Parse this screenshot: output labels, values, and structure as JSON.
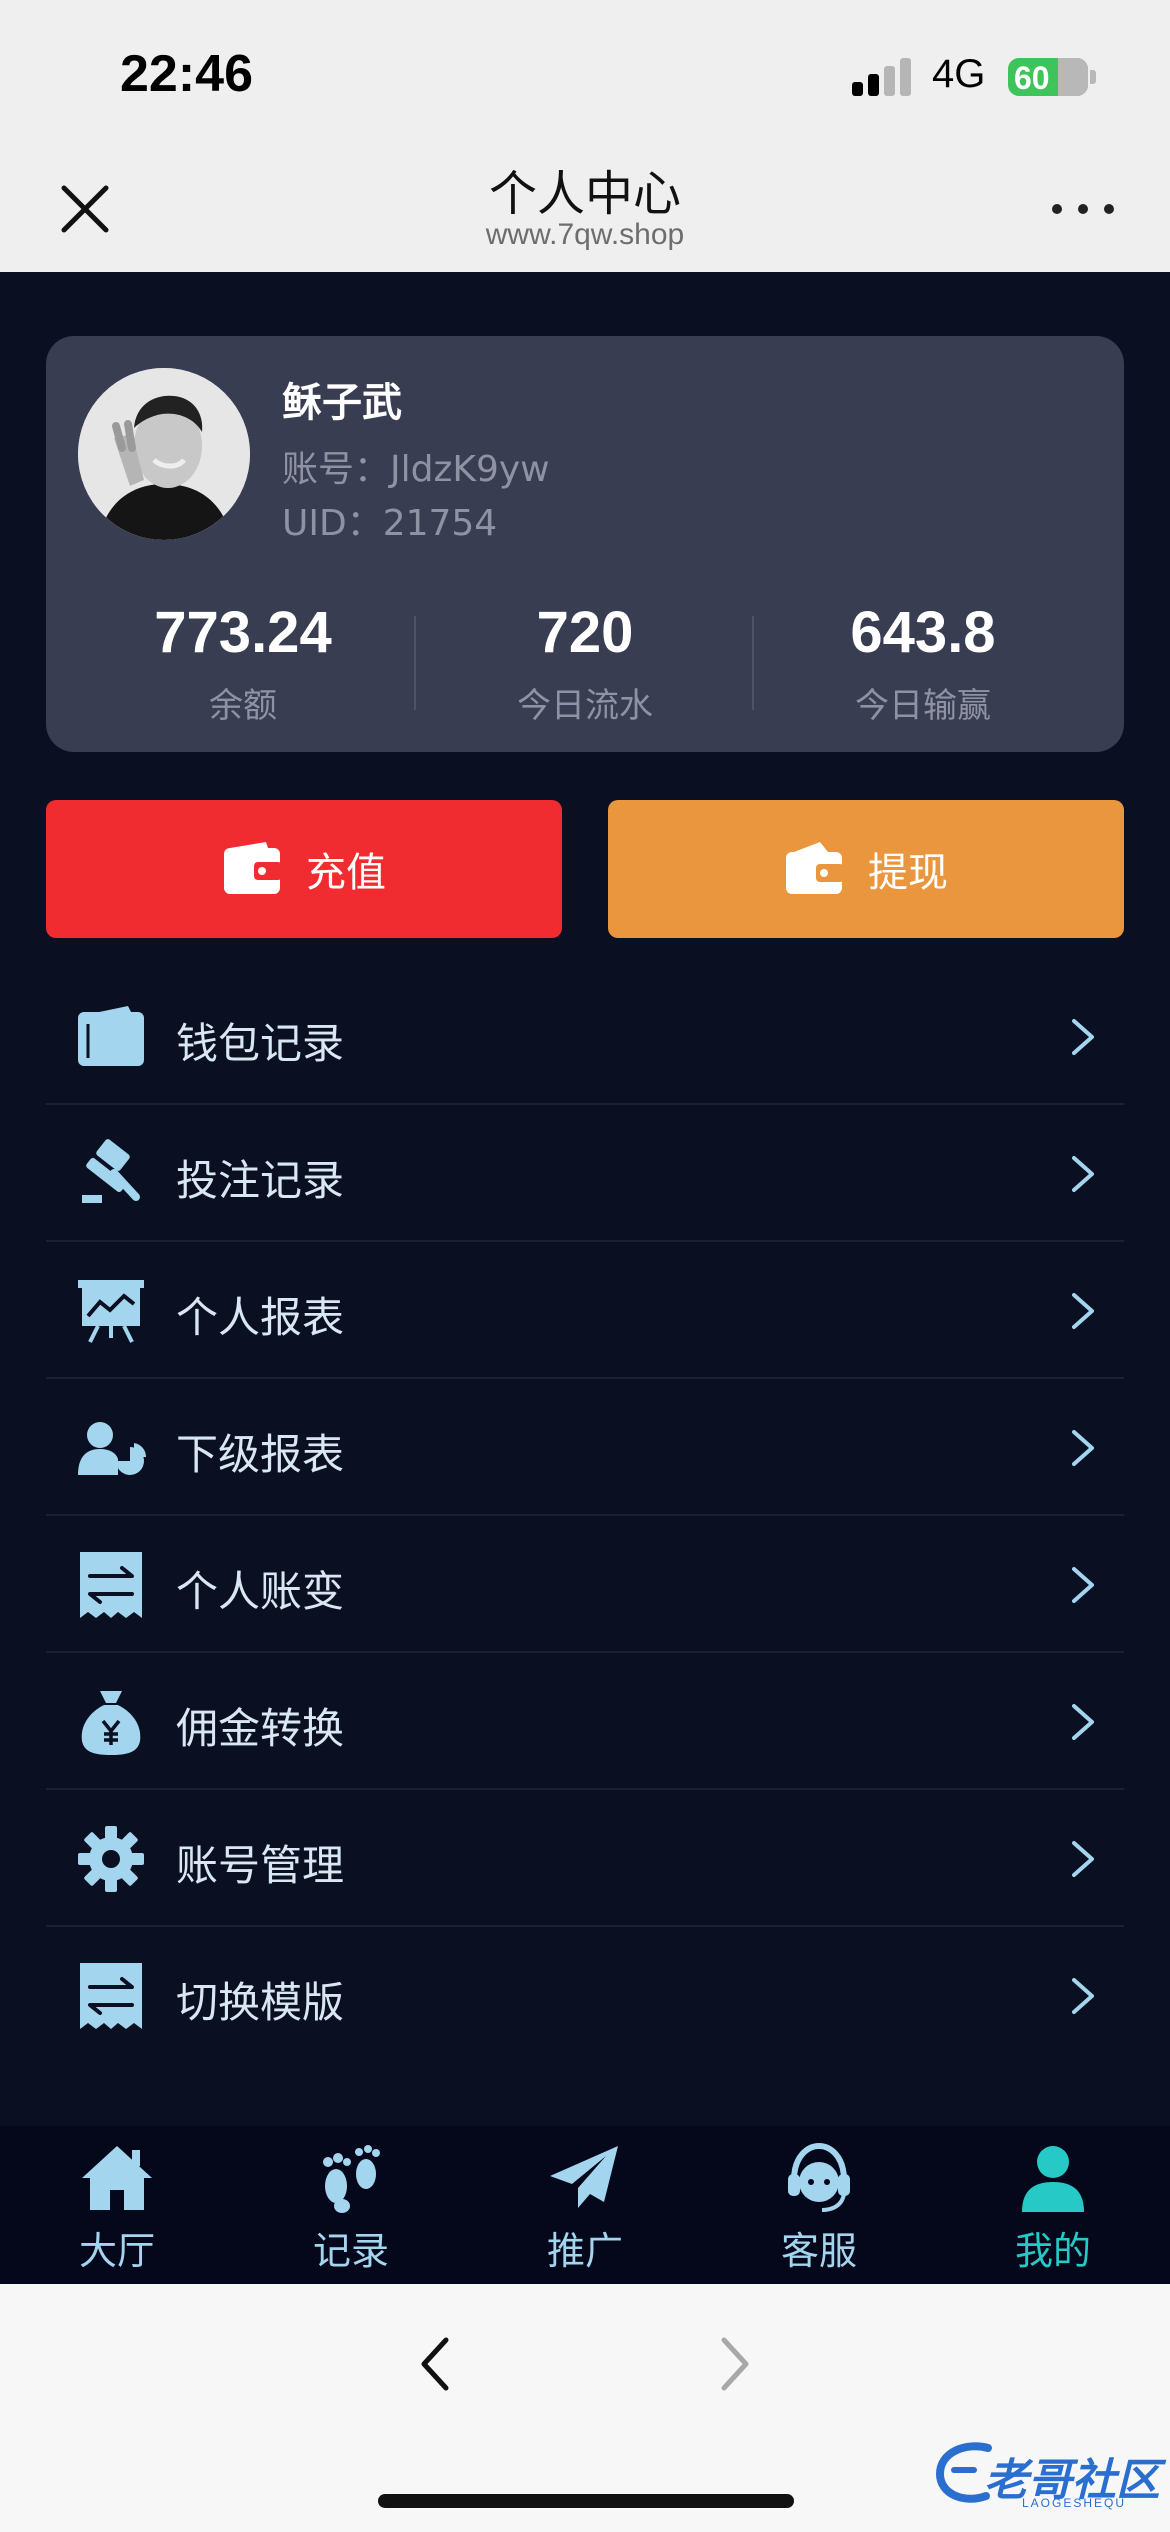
{
  "status_bar": {
    "time": "22:46",
    "network": "4G",
    "battery": "60"
  },
  "header": {
    "title": "个人中心",
    "subtitle": "www.7qw.shop"
  },
  "profile": {
    "name": "稣子武",
    "account": "账号：JldzK9yw",
    "uid": "UID：21754"
  },
  "stats": [
    {
      "value": "773.24",
      "label": "余额"
    },
    {
      "value": "720",
      "label": "今日流水"
    },
    {
      "value": "643.8",
      "label": "今日输赢"
    }
  ],
  "actions": {
    "recharge": "充值",
    "withdraw": "提现"
  },
  "menu": [
    {
      "label": "钱包记录",
      "icon": "wallet-icon"
    },
    {
      "label": "投注记录",
      "icon": "gavel-icon"
    },
    {
      "label": "个人报表",
      "icon": "chart-board-icon"
    },
    {
      "label": "下级报表",
      "icon": "user-pie-icon"
    },
    {
      "label": "个人账变",
      "icon": "transfer-receipt-icon"
    },
    {
      "label": "佣金转换",
      "icon": "money-bag-icon"
    },
    {
      "label": "账号管理",
      "icon": "gear-icon"
    },
    {
      "label": "切换模版",
      "icon": "switch-receipt-icon"
    }
  ],
  "tabs": [
    {
      "label": "大厅",
      "icon": "home-icon"
    },
    {
      "label": "记录",
      "icon": "footprint-icon"
    },
    {
      "label": "推广",
      "icon": "paper-plane-icon"
    },
    {
      "label": "客服",
      "icon": "headset-icon"
    },
    {
      "label": "我的",
      "icon": "user-icon"
    }
  ],
  "active_tab": "我的",
  "watermark": {
    "text": "老哥社区",
    "sub": "LAOGESHEQU"
  },
  "colors": {
    "background": "#0a0f22",
    "card": "#393d51",
    "recharge": "#f02c31",
    "withdraw": "#ea963e",
    "icon": "#a3d5ee",
    "active_tab": "#26c9c5"
  }
}
